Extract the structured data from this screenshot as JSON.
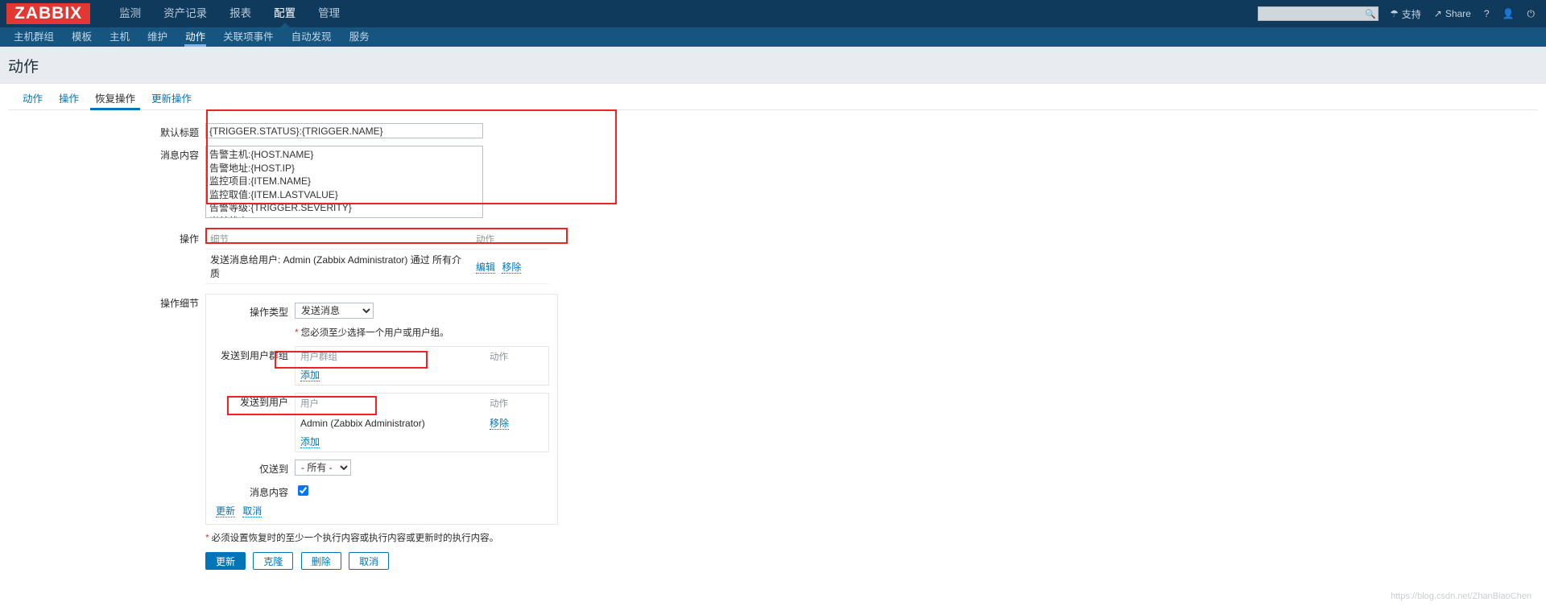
{
  "header": {
    "logo": "ZABBIX",
    "nav": [
      {
        "label": "监测",
        "active": false
      },
      {
        "label": "资产记录",
        "active": false
      },
      {
        "label": "报表",
        "active": false
      },
      {
        "label": "配置",
        "active": true
      },
      {
        "label": "管理",
        "active": false
      }
    ],
    "search_placeholder": "",
    "search_value": "",
    "support_label": "支持",
    "share_label": "Share",
    "help_label": "?",
    "user_label": "",
    "signout_label": ""
  },
  "subnav": [
    {
      "label": "主机群组",
      "active": false
    },
    {
      "label": "模板",
      "active": false
    },
    {
      "label": "主机",
      "active": false
    },
    {
      "label": "维护",
      "active": false
    },
    {
      "label": "动作",
      "active": true
    },
    {
      "label": "关联项事件",
      "active": false
    },
    {
      "label": "自动发现",
      "active": false
    },
    {
      "label": "服务",
      "active": false
    }
  ],
  "page_title": "动作",
  "tabs": [
    {
      "label": "动作",
      "active": false
    },
    {
      "label": "操作",
      "active": false
    },
    {
      "label": "恢复操作",
      "active": true
    },
    {
      "label": "更新操作",
      "active": false
    }
  ],
  "form": {
    "default_subject_label": "默认标题",
    "default_subject_value": "{TRIGGER.STATUS}:{TRIGGER.NAME}",
    "message_label": "消息内容",
    "message_value": "告警主机:{HOST.NAME}\n告警地址:{HOST.IP}\n监控项目:{ITEM.NAME}\n监控取值:{ITEM.LASTVALUE}\n告警等级:{TRIGGER.SEVERITY}\n当前状态:{TRIGGER.STATUS}\n恢复时间:{EVENT.RECOVERYDATE}{EVENT.RECOVERYTIME}",
    "operations_label": "操作",
    "op_col_details": "细节",
    "op_col_action": "动作",
    "op_rows": [
      {
        "details": "发送消息给用户: Admin (Zabbix Administrator) 通过 所有介质",
        "edit_label": "编辑",
        "remove_label": "移除"
      }
    ],
    "op_details_label": "操作细节",
    "op_type_label": "操作类型",
    "op_type_value": "发送消息",
    "op_type_options": [
      "发送消息"
    ],
    "op_required_hint": "您必须至少选择一个用户或用户组。",
    "usergroup_label": "发送到用户群组",
    "usergroup_col_name": "用户群组",
    "usergroup_col_action": "动作",
    "usergroup_rows": [],
    "usergroup_add_label": "添加",
    "user_label": "发送到用户",
    "user_col_name": "用户",
    "user_col_action": "动作",
    "user_rows": [
      {
        "name": "Admin (Zabbix Administrator)",
        "remove_label": "移除"
      }
    ],
    "user_add_label": "添加",
    "sendonly_label": "仅送到",
    "sendonly_value": "- 所有 -",
    "sendonly_options": [
      "- 所有 -"
    ],
    "custom_message_label": "消息内容",
    "custom_message_checked": true,
    "update_link_label": "更新",
    "cancel_link_label": "取消",
    "bottom_hint": "必须设置恢复时的至少一个执行内容或执行内容或更新时的执行内容。"
  },
  "buttons": {
    "update": "更新",
    "clone": "克隆",
    "delete": "删除",
    "cancel": "取消"
  },
  "watermark": "https://blog.csdn.net/ZhanBiaoChen",
  "colors": {
    "brand_red": "#e33734",
    "header_blue": "#0f3a5c",
    "subnav_blue": "#16557f",
    "link_blue": "#0275b8",
    "annotation_red": "#ee2222"
  }
}
